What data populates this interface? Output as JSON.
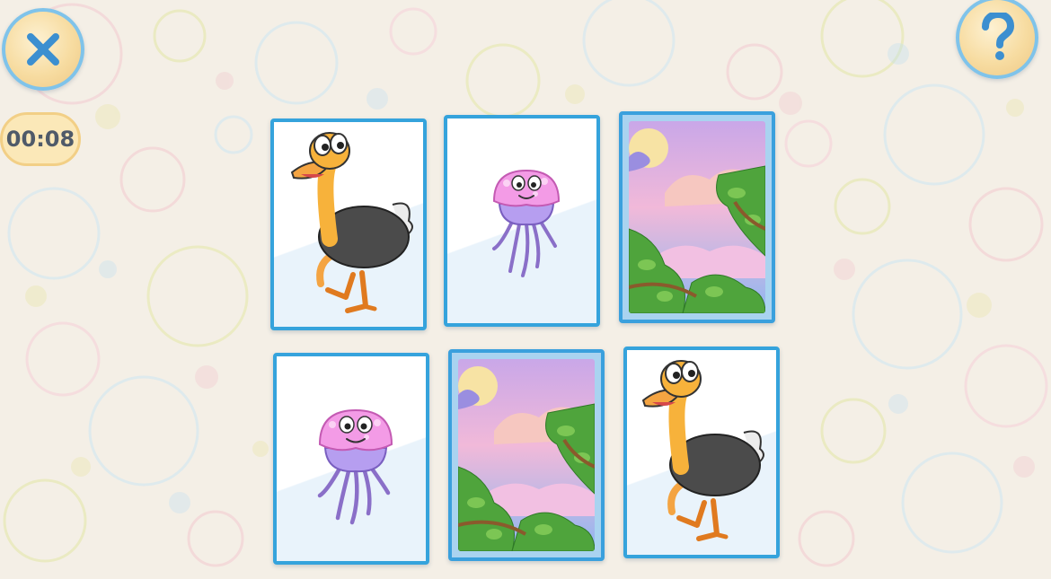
{
  "timer": {
    "text": "00:08"
  },
  "controls": {
    "close_icon": "close-icon",
    "help_icon": "help-icon"
  },
  "cards": [
    {
      "state": "face-up",
      "face": "ostrich"
    },
    {
      "state": "face-up",
      "face": "jellyfish"
    },
    {
      "state": "face-down",
      "face": "card-back-sky"
    },
    {
      "state": "face-up",
      "face": "jellyfish"
    },
    {
      "state": "face-down",
      "face": "card-back-sky"
    },
    {
      "state": "face-up",
      "face": "ostrich"
    }
  ],
  "colors": {
    "card_border": "#35a3dc",
    "button_ring": "#7fc3ea",
    "button_fill": "#f7dca1",
    "timer_text": "#4f5a69"
  }
}
